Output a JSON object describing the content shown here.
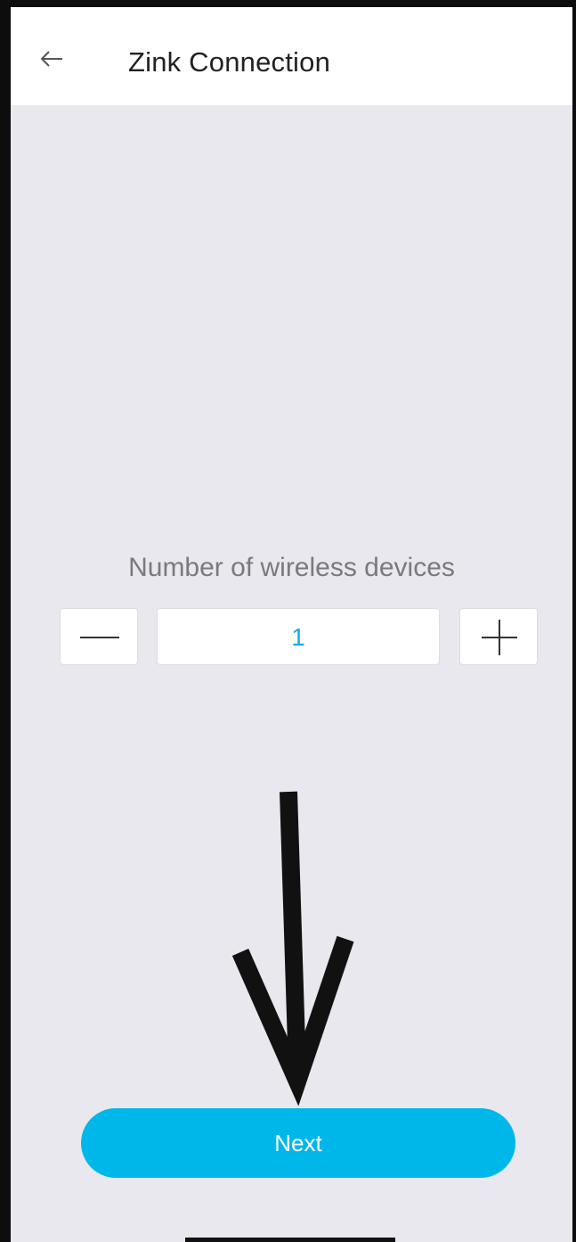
{
  "header": {
    "title": "Zink Connection",
    "back_icon": "arrow-left-icon"
  },
  "main": {
    "label": "Number of wireless devices",
    "stepper": {
      "value": "1",
      "minus_icon": "minus-icon",
      "plus_icon": "plus-icon"
    },
    "annotation": "down-arrow-icon",
    "next_label": "Next"
  },
  "colors": {
    "accent": "#00b7ea",
    "value_text": "#1aa8e0",
    "background": "#e9e8ee"
  }
}
